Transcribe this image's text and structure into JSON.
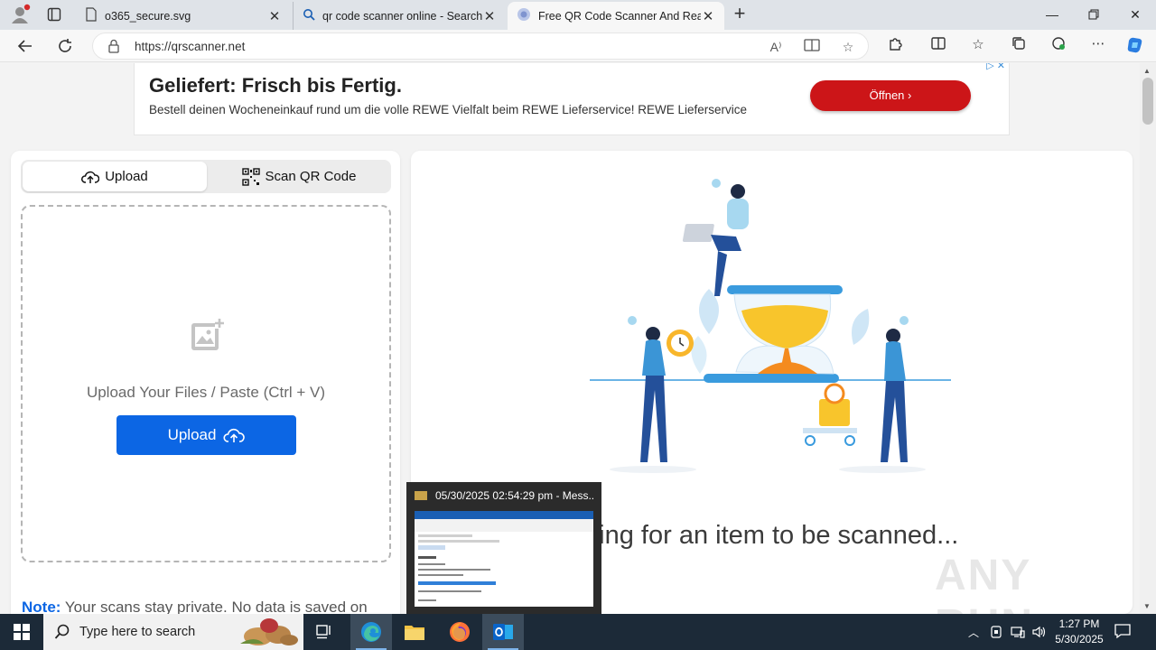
{
  "browser": {
    "tabs": [
      {
        "title": "o365_secure.svg",
        "icon": "document-icon"
      },
      {
        "title": "qr code scanner online - Search",
        "icon": "search-icon"
      },
      {
        "title": "Free QR Code Scanner And Reader",
        "icon": "qr-site-icon",
        "active": true
      }
    ],
    "url": "https://qrscanner.net"
  },
  "ad": {
    "title": "Geliefert: Frisch bis Fertig.",
    "text": "Bestell deinen Wocheneinkauf rund um die volle REWE Vielfalt beim REWE Lieferservice! REWE Lieferservice",
    "button_label": "Öffnen",
    "button_color": "#cc1518"
  },
  "scanner": {
    "tab_upload": "Upload",
    "tab_scan": "Scan QR Code",
    "drop_text": "Upload Your Files / Paste (Ctrl + V)",
    "upload_button": "Upload",
    "note_label": "Note:",
    "note_text": "Your scans stay private. No data is saved on",
    "waiting_text": "iting for an item to be scanned...",
    "accent_color": "#0c66e4"
  },
  "watermark": "ANY RUN",
  "popup": {
    "title": "05/30/2025 02:54:29 pm - Mess..."
  },
  "taskbar": {
    "search_placeholder": "Type here to search",
    "time": "1:27 PM",
    "date": "5/30/2025"
  }
}
